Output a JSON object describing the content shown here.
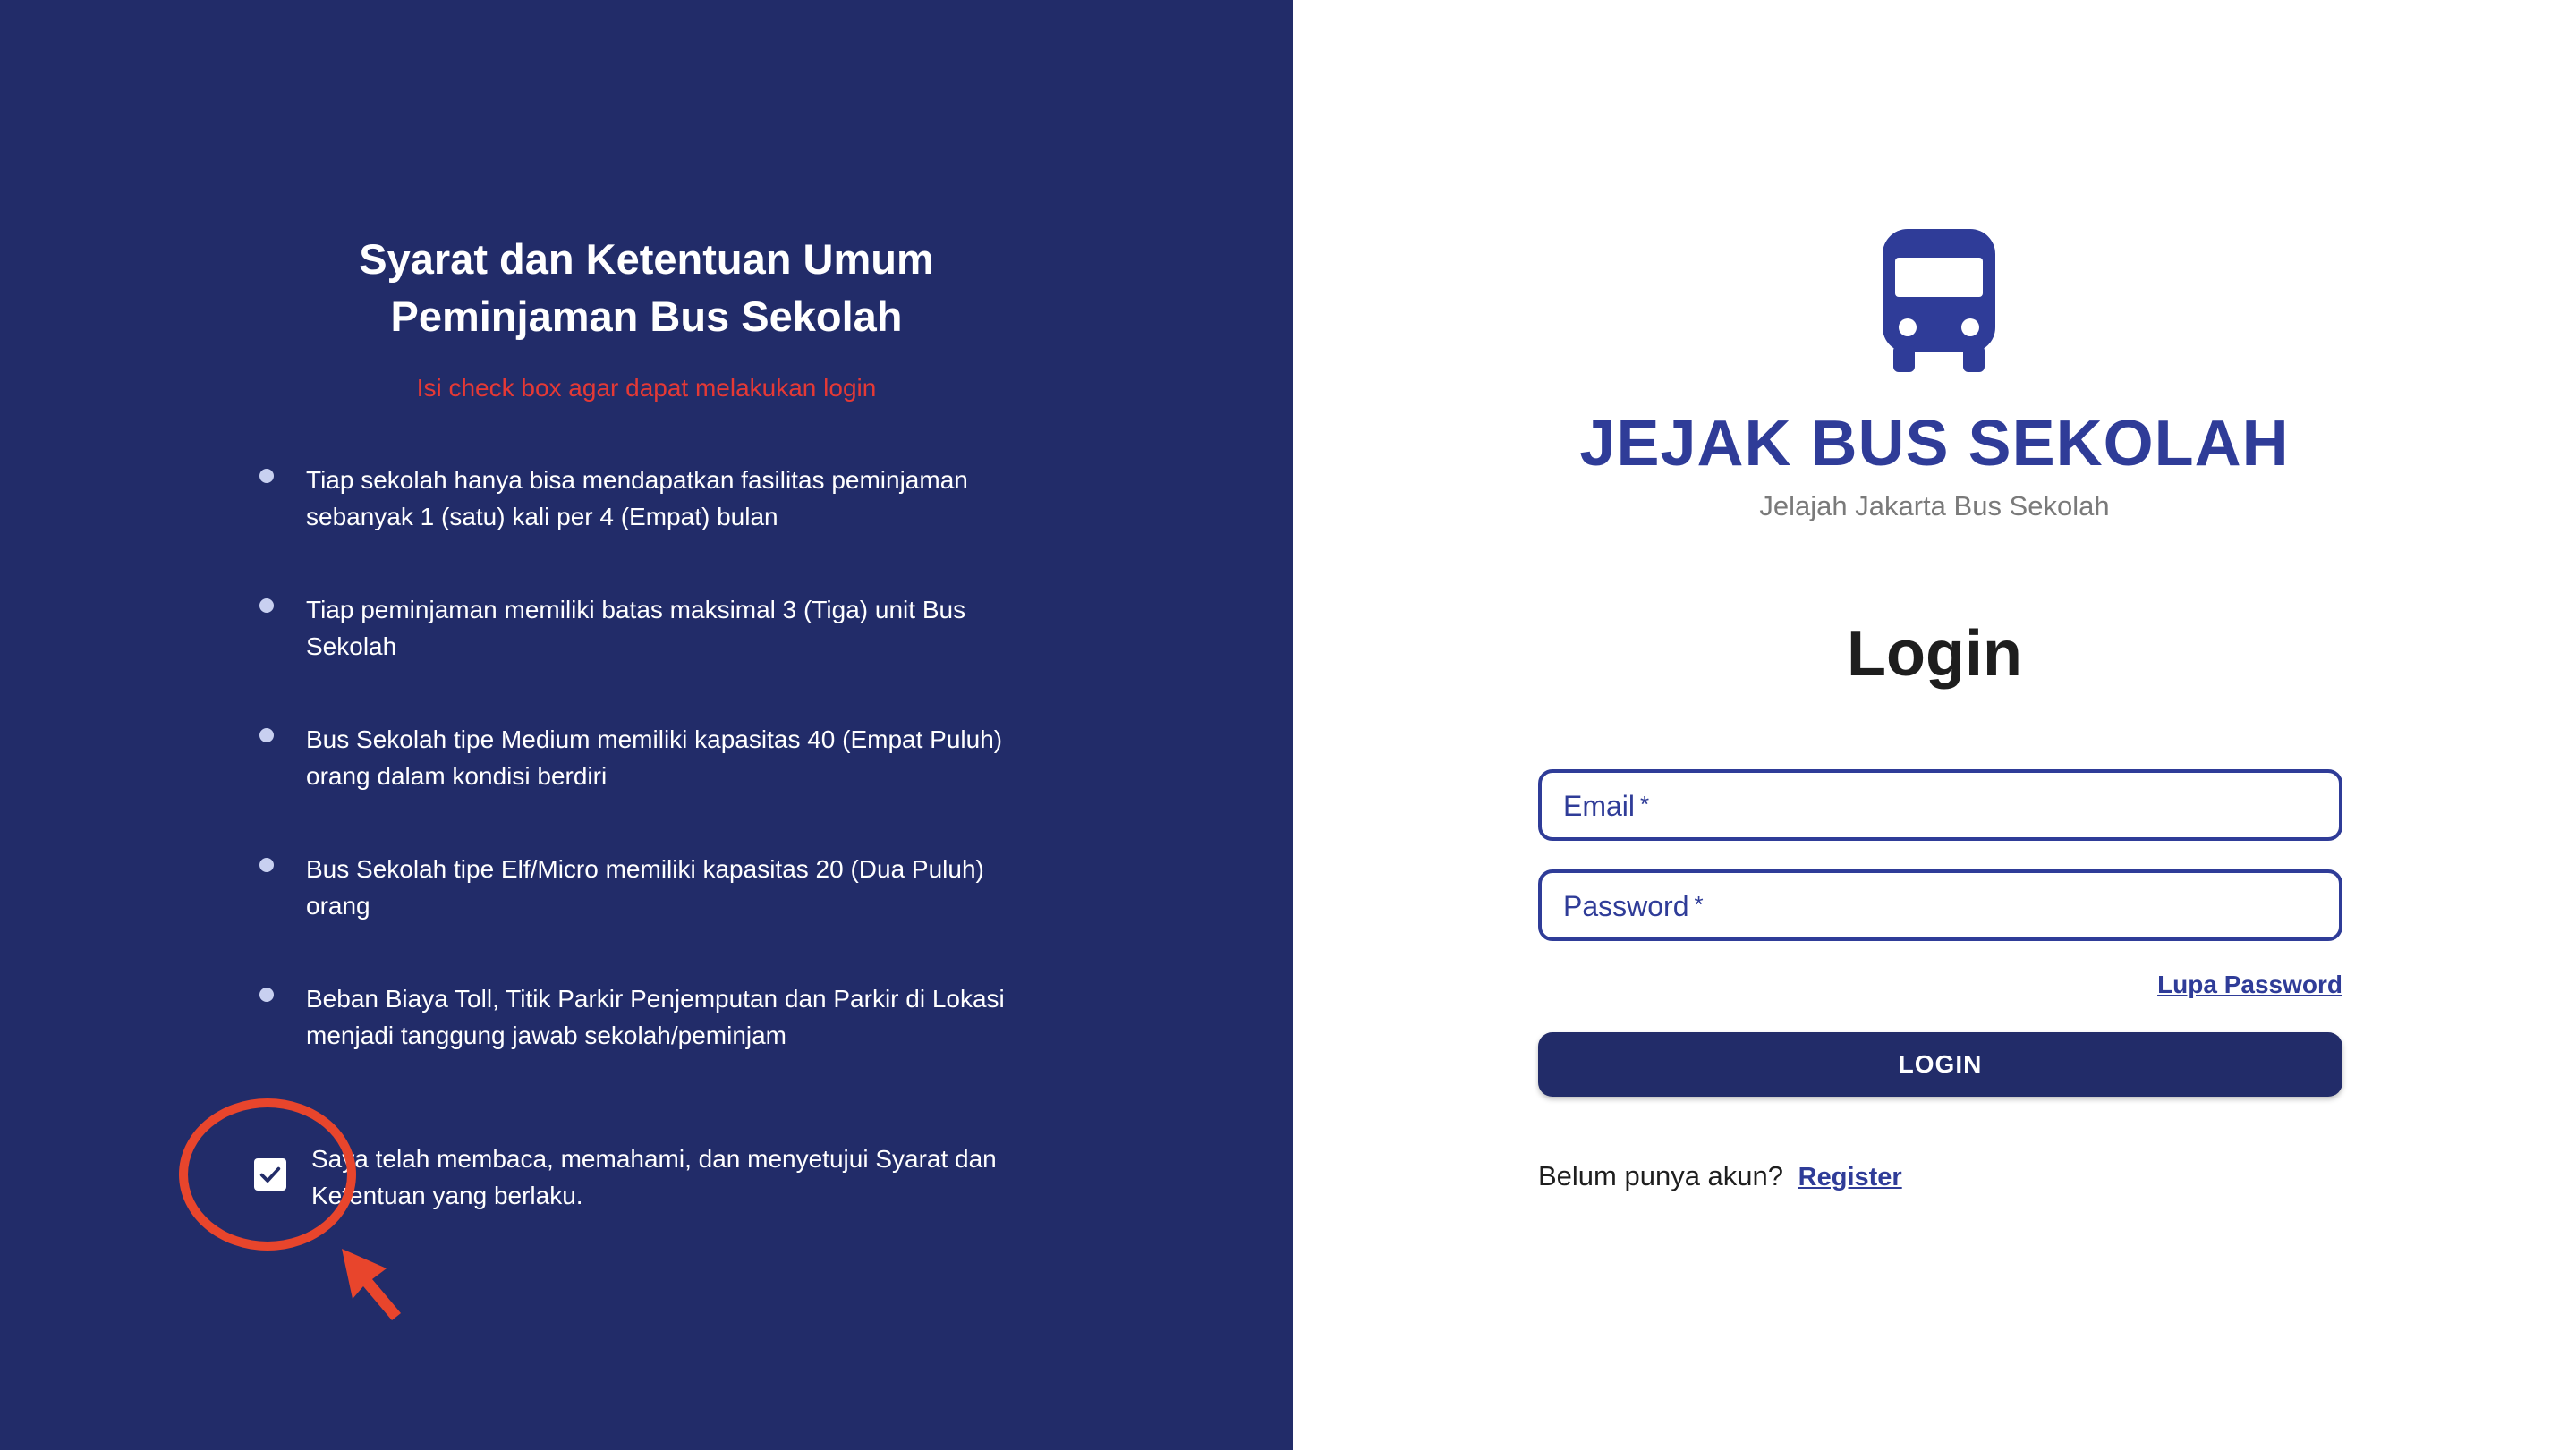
{
  "terms": {
    "title_line1": "Syarat dan Ketentuan Umum",
    "title_line2": "Peminjaman Bus Sekolah",
    "warning": "Isi check box agar dapat melakukan login",
    "items": [
      "Tiap sekolah hanya bisa mendapatkan fasilitas peminjaman sebanyak 1 (satu) kali per 4 (Empat) bulan",
      "Tiap peminjaman memiliki batas maksimal 3 (Tiga) unit Bus Sekolah",
      "Bus Sekolah tipe Medium memiliki kapasitas 40 (Empat Puluh) orang dalam kondisi berdiri",
      "Bus Sekolah tipe Elf/Micro memiliki kapasitas 20 (Dua Puluh) orang",
      "Beban Biaya Toll, Titik Parkir Penjemputan dan Parkir di Lokasi menjadi tanggung jawab sekolah/peminjam"
    ],
    "agree_checked": true,
    "agree_text": "Saya telah membaca, memahami, dan menyetujui Syarat dan Ketentuan yang berlaku."
  },
  "brand": {
    "logo_icon": "bus-icon",
    "title": "JEJAK BUS SEKOLAH",
    "subtitle": "Jelajah Jakarta Bus Sekolah"
  },
  "login": {
    "heading": "Login",
    "email_label": "Email",
    "password_label": "Password",
    "required_mark": "*",
    "forgot_label": "Lupa Password",
    "submit_label": "LOGIN",
    "register_prompt": "Belum punya akun?",
    "register_label": "Register"
  },
  "colors": {
    "panel_bg": "#222c69",
    "accent": "#2f3c98",
    "warning": "#e53935",
    "annotation": "#e8452c"
  }
}
